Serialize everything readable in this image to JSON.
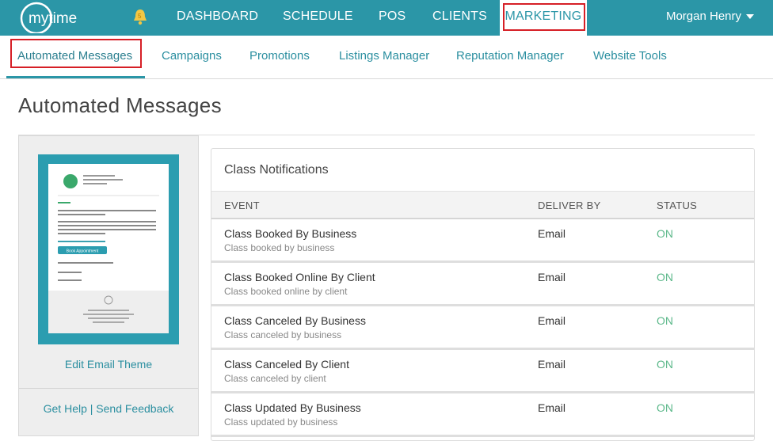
{
  "brand": {
    "logo_text": "mytime",
    "accent": "#2b96a7",
    "highlight": "#d61f26"
  },
  "topnav": {
    "notification_badge": "5",
    "items": [
      {
        "label": "DASHBOARD"
      },
      {
        "label": "SCHEDULE"
      },
      {
        "label": "POS"
      },
      {
        "label": "CLIENTS"
      },
      {
        "label": "MARKETING"
      }
    ],
    "user_name": "Morgan Henry"
  },
  "subnav": {
    "items": [
      {
        "label": "Automated Messages"
      },
      {
        "label": "Campaigns"
      },
      {
        "label": "Promotions"
      },
      {
        "label": "Listings Manager"
      },
      {
        "label": "Reputation Manager"
      },
      {
        "label": "Website Tools"
      }
    ]
  },
  "page": {
    "title": "Automated Messages"
  },
  "left_panel": {
    "preview_button": "Book Appointment",
    "edit_theme": "Edit Email Theme",
    "get_help": "Get Help",
    "separator": "|",
    "send_feedback": "Send Feedback"
  },
  "card": {
    "title": "Class Notifications",
    "columns": {
      "event": "EVENT",
      "deliver_by": "DELIVER BY",
      "status": "STATUS"
    },
    "rows": [
      {
        "name": "Class Booked By Business",
        "desc": "Class booked by business",
        "deliver": "Email",
        "status": "ON"
      },
      {
        "name": "Class Booked Online By Client",
        "desc": "Class booked online by client",
        "deliver": "Email",
        "status": "ON"
      },
      {
        "name": "Class Canceled By Business",
        "desc": "Class canceled by business",
        "deliver": "Email",
        "status": "ON"
      },
      {
        "name": "Class Canceled By Client",
        "desc": "Class canceled by client",
        "deliver": "Email",
        "status": "ON"
      },
      {
        "name": "Class Updated By Business",
        "desc": "Class updated by business",
        "deliver": "Email",
        "status": "ON"
      }
    ]
  }
}
